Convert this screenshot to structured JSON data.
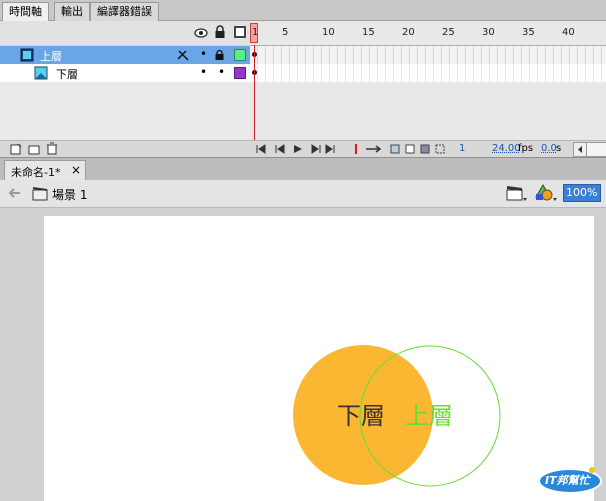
{
  "panel_tabs": [
    "時間軸",
    "輸出",
    "編譯器錯誤"
  ],
  "layers": [
    {
      "name": "上層",
      "selected": true,
      "color": "#55ee88"
    },
    {
      "name": "下層",
      "selected": false,
      "color": "#9933cc"
    }
  ],
  "ruler": [
    "1",
    "5",
    "10",
    "15",
    "20",
    "25",
    "30",
    "35",
    "40"
  ],
  "status": {
    "frame": "1",
    "fps": "24.00",
    "fps_unit": "fps",
    "time": "0.0",
    "time_unit": "s"
  },
  "document": {
    "tab": "未命名-1*",
    "close": "×"
  },
  "edit_bar": {
    "scene": "場景 1",
    "zoom": "100%"
  },
  "stage": {
    "lower_text": "下層",
    "upper_text": "上層",
    "lower_color": "#fbb731",
    "upper_color": "#66dd33"
  },
  "watermark": "IT邦幫忙"
}
